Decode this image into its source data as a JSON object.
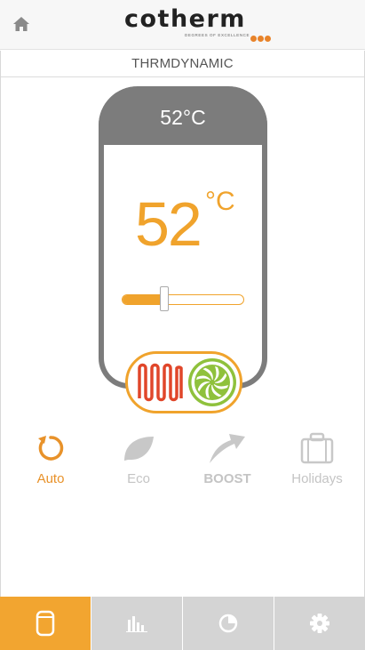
{
  "header": {
    "logo": "cotherm",
    "tagline": "DEGREES OF EXCELLENCE"
  },
  "mode_title": "THRMDYNAMIC",
  "tank": {
    "top_temp": "52°C",
    "setpoint_value": "52",
    "setpoint_unit": "°C",
    "slider_fraction": 0.35
  },
  "modes": [
    {
      "label": "Auto",
      "icon": "refresh-icon",
      "state": "active"
    },
    {
      "label": "Eco",
      "icon": "leaf-icon",
      "state": "inactive"
    },
    {
      "label": "BOOST",
      "icon": "boost-arrow-icon",
      "state": "inactive"
    },
    {
      "label": "Holidays",
      "icon": "suitcase-icon",
      "state": "inactive"
    }
  ],
  "tabs": [
    {
      "icon": "tank-icon",
      "active": true
    },
    {
      "icon": "bar-chart-icon",
      "active": false
    },
    {
      "icon": "pie-chart-icon",
      "active": false
    },
    {
      "icon": "gear-icon",
      "active": false
    }
  ],
  "colors": {
    "accent": "#f0a32c",
    "tank_gray": "#7c7c7c",
    "heater_red": "#e0462a",
    "fan_green": "#8fc13c",
    "inactive": "#c4c4c4"
  }
}
